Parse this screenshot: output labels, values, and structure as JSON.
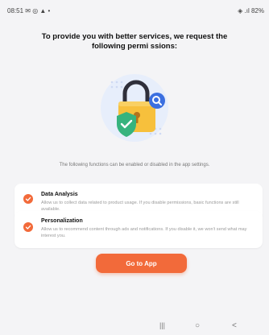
{
  "status_bar": {
    "time": "08:51",
    "left_icons": "✉ ◎ ▲ •",
    "right_text": "82%"
  },
  "permission_screen": {
    "title": "To provide you with better services, we request the following permi ssions:",
    "subtitle": "The following functions can be enabled or disabled in the app settings.",
    "permissions": [
      {
        "title": "Data Analysis",
        "description": "Allow us to collect data related to product usage. If you disable permissions, basic functions are still available."
      },
      {
        "title": "Personalization",
        "description": "Allow us to recommend content through ads and notifications. If you disable it, we won't send what may interest you."
      }
    ],
    "go_button_label": "Go to App"
  },
  "colors": {
    "accent": "#f26a3a",
    "lock_body": "#f7c03c",
    "shield": "#36b37e",
    "search_badge": "#3b6fe0"
  },
  "nav_bar": {
    "recent": "|||",
    "home": "○",
    "back": "<"
  }
}
